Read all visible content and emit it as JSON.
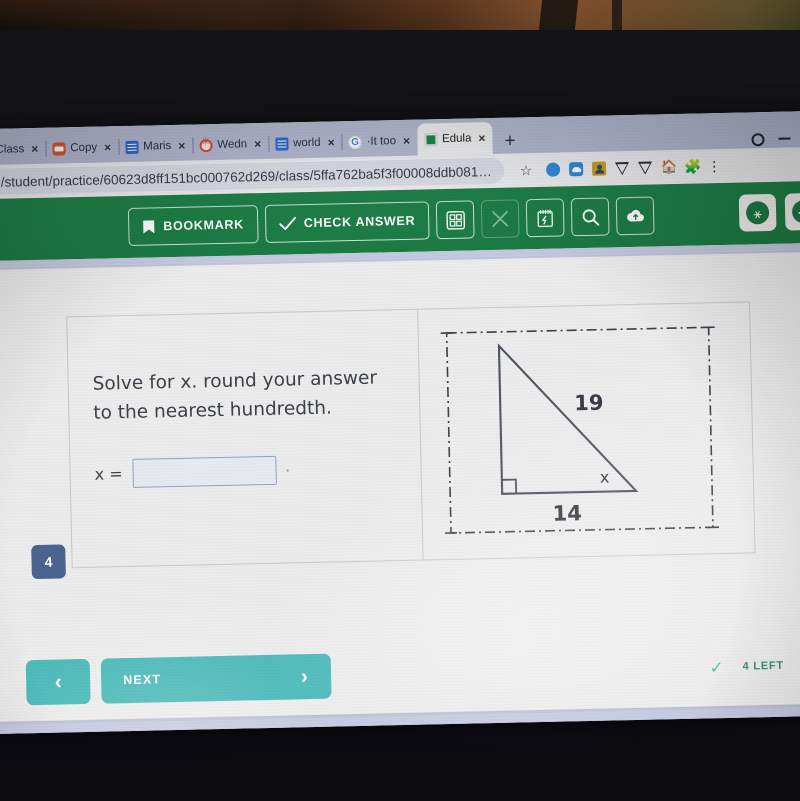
{
  "browser": {
    "tabs": [
      {
        "label": "Class",
        "favicon": "generic-icon",
        "close": "×"
      },
      {
        "label": "Copy",
        "favicon": "orange-doc-icon",
        "close": "×"
      },
      {
        "label": "Maris",
        "favicon": "blue-doc-icon",
        "close": "×"
      },
      {
        "label": "Wedn",
        "favicon": "red-asterisk-icon",
        "close": "×"
      },
      {
        "label": "world",
        "favicon": "blue-doc-icon",
        "close": "×"
      },
      {
        "label": "·It too",
        "favicon": "google-icon",
        "close": "×"
      },
      {
        "label": "Edula",
        "favicon": "green-sheet-icon",
        "close": "×"
      }
    ],
    "new_tab_label": "+",
    "url": "com/student/practice/60623d8ff151bc000762d269/class/5ffa762ba5f3f00008ddb081…",
    "star": "☆",
    "window_controls": {
      "profile": "profile-icon",
      "minimize": "–",
      "maximize": "maximize-icon",
      "close": "×"
    },
    "extensions": [
      "blue-circle-icon",
      "blue-cloud-icon",
      "yellow-person-icon",
      "shield-icon",
      "shield-icon",
      "house-icon",
      "puzzle-icon"
    ],
    "menu": "⋮"
  },
  "app": {
    "toolbar": {
      "bookmark_label": "BOOKMARK",
      "check_answer_label": "CHECK ANSWER",
      "calculator_icon": "calculator-icon",
      "close_icon": "×",
      "notes_icon": "notepad-icon",
      "search_icon": "magnifier-icon",
      "upload_icon": "cloud-upload-icon"
    },
    "header_right": {
      "accessibility_icon": "accessibility-icon",
      "reset_icon": "reset-arrow-icon"
    },
    "brand_green": "#1c7a43"
  },
  "question": {
    "number": "4",
    "prompt": "Solve for x. round your answer to the nearest hundredth.",
    "answer_label": "x =",
    "answer_value": "",
    "answer_placeholder": ""
  },
  "figure": {
    "type": "right-triangle",
    "hypotenuse_label": "19",
    "base_label": "14",
    "angle_label": "x",
    "right_angle_marker": true,
    "stroke": "#4e5360",
    "border_style": "dash-dot"
  },
  "footer": {
    "prev_label": "‹",
    "next_label": "NEXT",
    "next_chevron": "›",
    "status_check": "✓",
    "status_text": "4 LEFT",
    "status_color": "#2f8f6a",
    "button_color": "#46b8b8"
  }
}
